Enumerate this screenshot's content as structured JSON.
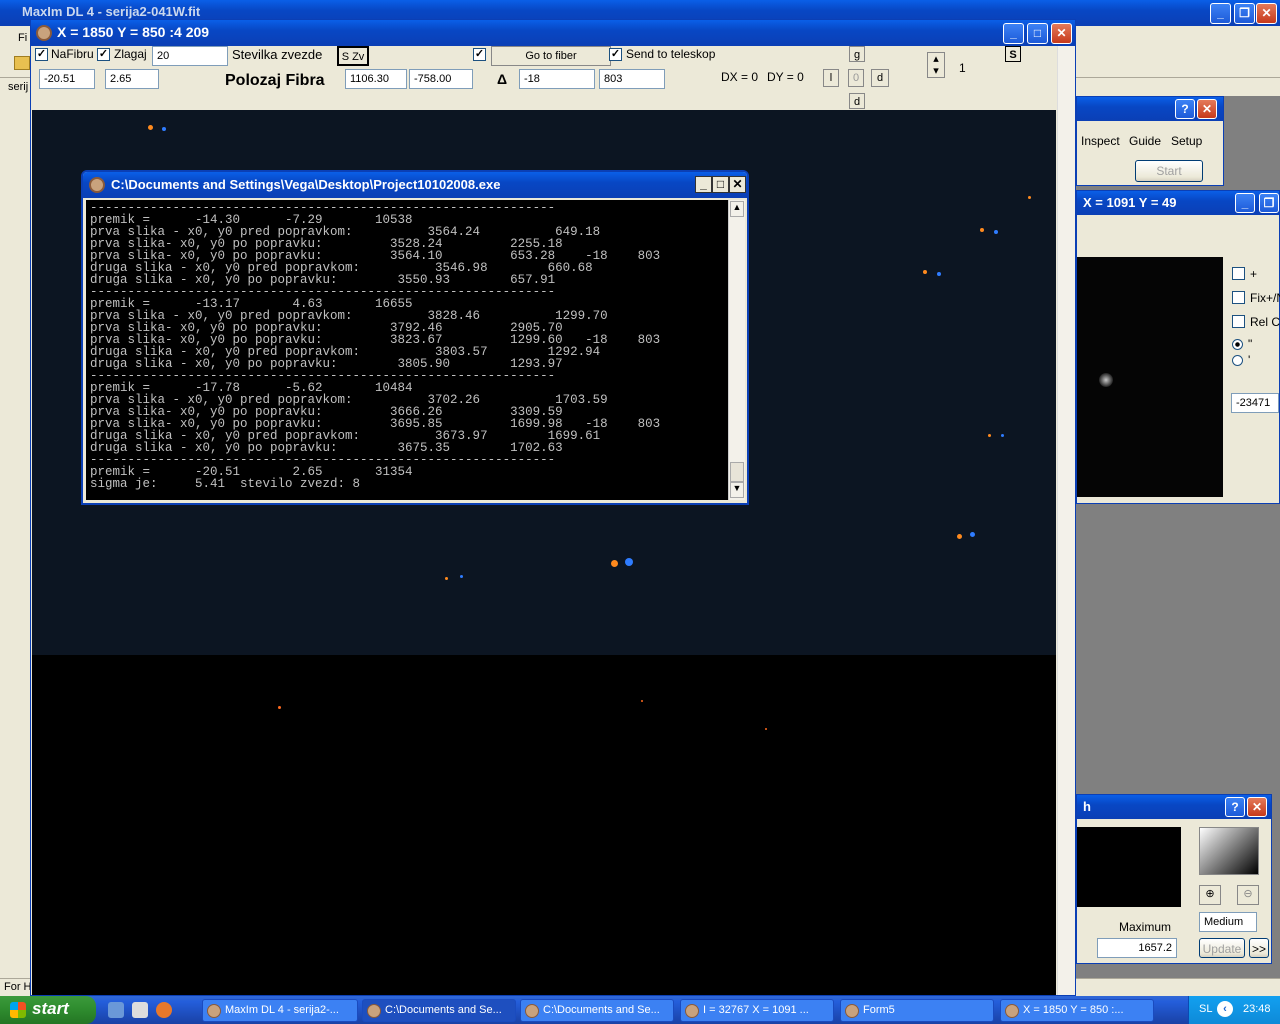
{
  "maxim": {
    "title": "MaxIm DL 4 - serija2-041W.fit",
    "menu_first": "Fi",
    "tab_label": "serij",
    "status_text": "For H"
  },
  "fiber": {
    "title": "X = 1850   Y = 850   :4    209",
    "nafibru_label": "NaFibru",
    "zlagaj_label": "Zlagaj",
    "stevilka_value": "20",
    "stevilka_label": "Stevilka zvezde",
    "szv_label": "S Zv",
    "go_to_fiber_label": "Go to fiber",
    "send_label": "Send to teleskop",
    "g_label": "g",
    "s_label": "S",
    "field1": "-20.51",
    "field2": "2.65",
    "polozaj_label": "Polozaj Fibra",
    "pos_x": "1106.30",
    "pos_y": "-758.00",
    "delta_label": "Δ",
    "delta_x": "-18",
    "delta_y": "803",
    "dx_label": "DX = 0",
    "dy_label": "DY = 0",
    "btn_l": "l",
    "btn_0": "0",
    "btn_d": "d",
    "btn_d2": "d",
    "spin_value": "1"
  },
  "console": {
    "title": "C:\\Documents and Settings\\Vega\\Desktop\\Project10102008.exe",
    "lines": "--------------------------------------------------------------\npremik =      -14.30      -7.29       10538\nprva slika - x0, y0 pred popravkom:          3564.24          649.18\nprva slika- x0, y0 po popravku:         3528.24         2255.18\nprva slika- x0, y0 po popravku:         3564.10         653.28    -18    803\ndruga slika - x0, y0 pred popravkom:          3546.98        660.68\ndruga slika - x0, y0 po popravku:        3550.93        657.91\n--------------------------------------------------------------\npremik =      -13.17       4.63       16655\nprva slika - x0, y0 pred popravkom:          3828.46          1299.70\nprva slika- x0, y0 po popravku:         3792.46         2905.70\nprva slika- x0, y0 po popravku:         3823.67         1299.60   -18    803\ndruga slika - x0, y0 pred popravkom:          3803.57        1292.94\ndruga slika - x0, y0 po popravku:        3805.90        1293.97\n--------------------------------------------------------------\npremik =      -17.78      -5.62       10484\nprva slika - x0, y0 pred popravkom:          3702.26          1703.59\nprva slika- x0, y0 po popravku:         3666.26         3309.59\nprva slika- x0, y0 po popravku:         3695.85         1699.98   -18    803\ndruga slika - x0, y0 pred popravkom:          3673.97        1699.61\ndruga slika - x0, y0 po popravku:        3675.35        1702.63\n--------------------------------------------------------------\npremik =      -20.51       2.65       31354\nsigma je:     5.41  stevilo zvezd: 8\n_"
  },
  "camera_panel": {
    "tabs": [
      "Inspect",
      "Guide",
      "Setup"
    ],
    "start_label": "Start"
  },
  "info_panel": {
    "title": "X = 1091   Y = 49",
    "cb_plus": "+",
    "cb_fix": "Fix+/N",
    "cb_rel": "Rel C",
    "radio1": "\"",
    "radio2": "'",
    "value": "-23471"
  },
  "screen_panel": {
    "title": "h",
    "maximum_label": "Maximum",
    "maximum_value": "1657.2",
    "medium_label": "Medium",
    "update_label": "Update",
    "more_label": ">>"
  },
  "taskbar": {
    "start_label": "start",
    "tasks": [
      "MaxIm DL 4 - serija2-...",
      "C:\\Documents and Se...",
      "C:\\Documents and Se...",
      "I = 32767   X = 1091 ...",
      "Form5",
      "X = 1850   Y = 850   :..."
    ],
    "lang": "SL",
    "clock": "23:48"
  }
}
